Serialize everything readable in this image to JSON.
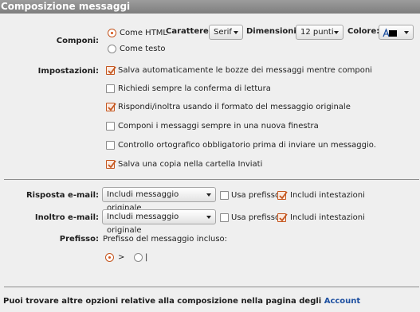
{
  "title": "Composizione messaggi",
  "componi": {
    "label": "Componi:",
    "options": [
      "Come HTML",
      "Come testo"
    ],
    "selected": 0
  },
  "toolbar": {
    "font_label": "Carattere:",
    "font_value": "Serif",
    "size_label": "Dimensioni:",
    "size_value": "12 punti",
    "color_label": "Colore:",
    "color_value": "#000000",
    "color_icon": "text-color-icon"
  },
  "impostazioni": {
    "label": "Impostazioni:",
    "items": [
      {
        "label": "Salva automaticamente le bozze dei messaggi mentre componi",
        "checked": true
      },
      {
        "label": "Richiedi sempre la conferma di lettura",
        "checked": false
      },
      {
        "label": "Rispondi/inoltra usando il formato del messaggio originale",
        "checked": true
      },
      {
        "label": "Componi i messaggi sempre in una nuova finestra",
        "checked": false
      },
      {
        "label": "Controllo ortografico obbligatorio prima di inviare un messaggio.",
        "checked": false
      },
      {
        "label": "Salva una copia nella cartella Inviati",
        "checked": true
      }
    ]
  },
  "risposta": {
    "label": "Risposta e-mail:",
    "select_value": "Includi messaggio originale",
    "prefix_label": "Usa prefisso",
    "prefix_checked": false,
    "headers_label": "Includi intestazioni",
    "headers_checked": true
  },
  "inoltro": {
    "label": "Inoltro e-mail:",
    "select_value": "Includi messaggio originale",
    "prefix_label": "Usa prefisso",
    "prefix_checked": false,
    "headers_label": "Includi intestazioni",
    "headers_checked": true
  },
  "prefisso": {
    "label": "Prefisso:",
    "text": "Prefisso del messaggio incluso:",
    "options": [
      ">",
      "|"
    ],
    "selected": 0
  },
  "footer": {
    "text": "Puoi trovare altre opzioni relative alla composizione nella pagina degli",
    "link": "Account"
  },
  "colors": {
    "accent": "#d6541a",
    "title_bar": "#8a8a8a",
    "link": "#1d4fa0"
  }
}
